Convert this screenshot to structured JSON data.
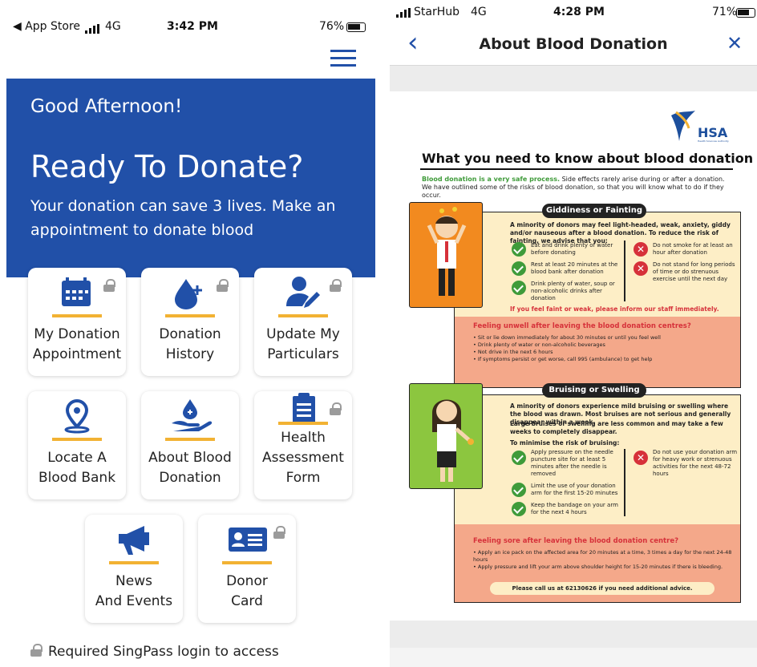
{
  "left": {
    "status": {
      "carrier": "◀ App Store",
      "network": "4G",
      "time": "3:42 PM",
      "battery": "76%"
    },
    "hero": {
      "greeting": "Good Afternoon!",
      "title": "Ready To Donate?",
      "subtitle": "Your donation can save 3 lives. Make an appointment to donate blood"
    },
    "tiles": [
      {
        "line1": "My Donation",
        "line2": "Appointment"
      },
      {
        "line1": "Donation",
        "line2": "History"
      },
      {
        "line1": "Update My",
        "line2": "Particulars"
      },
      {
        "line1": "Locate A",
        "line2": "Blood Bank"
      },
      {
        "line1": "About Blood",
        "line2": "Donation"
      },
      {
        "line1": "Health",
        "line2": "Assessment",
        "line3": "Form"
      },
      {
        "line1": "News",
        "line2": "And Events"
      },
      {
        "line1": "Donor",
        "line2": "Card"
      }
    ],
    "footer": "Required SingPass login to access",
    "colors": {
      "hero": "#2150a8",
      "accent": "#f2b233",
      "icon": "#2150a8"
    }
  },
  "right": {
    "status": {
      "carrier": "StarHub",
      "network": "4G",
      "time": "4:28 PM",
      "battery": "71%"
    },
    "nav": {
      "title": "About Blood Donation",
      "back": "‹",
      "close": "✕"
    },
    "poster": {
      "logo": "HSA",
      "logo_sub": "Health Sciences Authority",
      "title": "What you need to know about blood donation",
      "intro_bold": "Blood donation is a very safe process.",
      "intro": "Side effects rarely arise during or after a donation. We have outlined some of the risks of blood donation, so that you will know what to do if they occur.",
      "s1": {
        "head": "Giddiness or Fainting",
        "lead": "A minority of donors may feel light-headed, weak, anxiety, giddy and/or nauseous after a blood donation. To reduce the risk of fainting, we advise that you:",
        "do": [
          "Eat and drink plenty of water before donating",
          "Rest at least 20 minutes at the blood bank after donation",
          "Drink plenty of water, soup or non-alcoholic drinks after donation"
        ],
        "dont": [
          "Do not smoke for at least an hour after donation",
          "Do not stand for long periods of time or do strenuous exercise until the next day"
        ],
        "warn": "If you feel faint or weak, please inform our staff immediately.",
        "after_head": "Feeling unwell after leaving the blood donation centres?",
        "after": [
          "• Sit or lie down immediately for about 30 minutes or until you feel well",
          "• Drink plenty of water or non-alcoholic beverages",
          "• Not drive in the next 6 hours",
          "• If symptoms persist or get worse, call 995 (ambulance) to get help"
        ]
      },
      "s2": {
        "head": "Bruising or Swelling",
        "lead": "A minority of donors experience mild bruising or swelling where the blood was drawn. Most bruises are not serious and generally disappear within a week.",
        "lead2": "Large bruises or swelling are less common and may take a few weeks to completely disappear.",
        "min": "To minimise the risk of bruising:",
        "do": [
          "Apply pressure on the needle puncture site for at least 5 minutes after the needle is removed",
          "Limit the use of your donation arm for the first 15-20 minutes",
          "Keep the bandage on your arm for the next 4 hours"
        ],
        "dont": [
          "Do not use your donation arm for heavy work or strenuous activities for the next 48-72 hours"
        ],
        "after_head": "Feeling sore after leaving the blood donation centre?",
        "after": [
          "• Apply an ice pack on the affected area for 20 minutes at a time, 3 times a day for the next 24-48 hours",
          "• Apply pressure and lift your arm above shoulder height for 15-20 minutes if there is bleeding."
        ],
        "call": "Please call us at 62130626 if you need additional advice."
      }
    }
  }
}
